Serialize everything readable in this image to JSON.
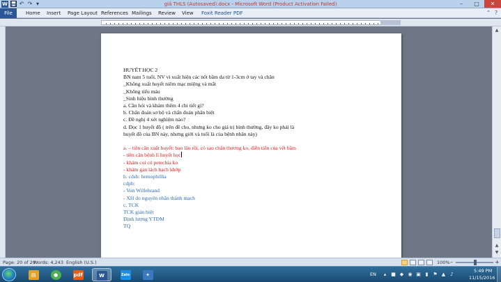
{
  "window": {
    "title": "giả THLS (Autosaved).docx - Microsoft Word (Product Activation Failed)"
  },
  "qat": {
    "word_icon": "W",
    "save_icon": "save-icon",
    "undo_icon": "↶",
    "redo_icon": "↷",
    "customize_icon": "▾"
  },
  "window_controls": {
    "minimize": "–",
    "maximize": "□",
    "close": "✕"
  },
  "ribbon": {
    "file": "File",
    "tabs": [
      "Home",
      "Insert",
      "Page Layout",
      "References",
      "Mailings",
      "Review",
      "View",
      "Foxit Reader PDF"
    ],
    "help_icon": "?",
    "expand_icon": "⌃"
  },
  "document": {
    "lines": [
      {
        "text": "HUYẾT HỌC 2",
        "color": "black"
      },
      {
        "text": "BN nam  5 tuổi, NV vì xuất hiện các nốt bầm da từ 1-3cm ở tay và chân",
        "color": "black"
      },
      {
        "text": "_Không xuất huyết niêm mạc miệng và mắt",
        "color": "black"
      },
      {
        "text": "_Không tiểu máu",
        "color": "black"
      },
      {
        "text": "_Sinh hiệu bình thường",
        "color": "black"
      },
      {
        "text": "a.  Cần hỏi và khám thêm 4 chi tiết gì?",
        "color": "black"
      },
      {
        "text": "b.  Chẩn đoán sơ bộ và chẩn đoán phân biệt",
        "color": "black"
      },
      {
        "text": "c.  Đề nghị 4 xét nghiệm nào?",
        "color": "black"
      },
      {
        "text": "d.  Đọc 1 huyết đồ ( trên đề cho, nhưng ko cho giá trị bình thường, đây ko phải là",
        "color": "black"
      },
      {
        "text": "huyết đồ của BN này, nhưng giới và tuổi là của bệnh nhân này)",
        "color": "black"
      },
      {
        "text": "",
        "color": "black"
      },
      {
        "text": "a. – tiền căn xuất huyết: bao lâu rồi, có sau chấn thương ko, diễn tiến của vết bầm",
        "color": "red"
      },
      {
        "text": "- tiền căn bệnh lí huyết học",
        "color": "red",
        "cursor": true
      },
      {
        "text": "- khám coi có petechia ko",
        "color": "red"
      },
      {
        "text": "- khám gan lách hạch khớp",
        "color": "red"
      },
      {
        "text": "b. cdsb: hemophillia",
        "color": "blue"
      },
      {
        "text": "cdpb:",
        "color": "blue"
      },
      {
        "text": "- Von Willebrand",
        "color": "blue"
      },
      {
        "text": "- XH do nguyên nhân thành mạch",
        "color": "blue"
      },
      {
        "text": "c. TCK",
        "color": "blue"
      },
      {
        "text": "TCK giản biệt",
        "color": "blue"
      },
      {
        "text": "Định lượng YTĐM",
        "color": "blue"
      },
      {
        "text": "TQ",
        "color": "blue"
      }
    ]
  },
  "statusbar": {
    "page": "Page: 20 of 20",
    "words": "Words: 4,243",
    "language": "English (U.S.)",
    "zoom": "100%",
    "zoom_minus": "–",
    "zoom_plus": "+"
  },
  "scrollbar": {
    "up_icon": "▲",
    "down_icon": "▼",
    "prev_page_icon": "▲",
    "next_page_icon": "▼"
  },
  "taskbar": {
    "apps": [
      {
        "name": "explorer",
        "label": "▤",
        "color": "#e0a42c"
      },
      {
        "name": "chrome",
        "label": "●",
        "color": "#4caf50"
      },
      {
        "name": "foxit",
        "label": "pdf",
        "color": "#e65c1b"
      },
      {
        "name": "word",
        "label": "W",
        "color": "#2b5797"
      },
      {
        "name": "zalo",
        "label": "Zalo",
        "color": "#1b8ee8"
      },
      {
        "name": "network-app",
        "label": "✦",
        "color": "#3a78c2"
      }
    ],
    "language": "EN",
    "time": "5:49 PM",
    "date": "11/15/2016"
  }
}
